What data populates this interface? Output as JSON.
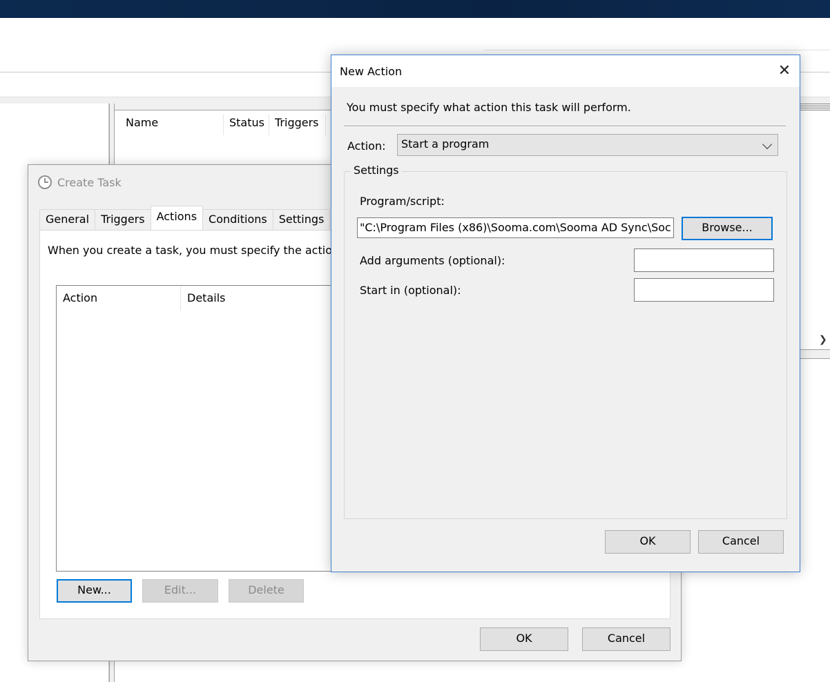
{
  "main_window": {
    "columns": [
      "Name",
      "Status",
      "Triggers"
    ]
  },
  "create_task": {
    "title": "Create Task",
    "tabs": [
      "General",
      "Triggers",
      "Actions",
      "Conditions",
      "Settings"
    ],
    "active_tab": "Actions",
    "description": "When you create a task, you must specify the actio",
    "list_columns": [
      "Action",
      "Details"
    ],
    "buttons": {
      "new": "New...",
      "edit": "Edit...",
      "delete": "Delete",
      "ok": "OK",
      "cancel": "Cancel"
    }
  },
  "new_action": {
    "title": "New Action",
    "intro": "You must specify what action this task will perform.",
    "action_label": "Action:",
    "action_value": "Start a program",
    "settings_label": "Settings",
    "program_label": "Program/script:",
    "program_value": "\"C:\\Program Files (x86)\\Sooma.com\\Sooma AD Sync\\Soc",
    "browse_label": "Browse...",
    "arguments_label": "Add arguments (optional):",
    "arguments_value": "",
    "start_in_label": "Start in (optional):",
    "start_in_value": "",
    "ok_label": "OK",
    "cancel_label": "Cancel"
  },
  "colors": {
    "accent": "#0078d7",
    "title_bar": "#0c2a4f",
    "dialog_bg": "#f0f0f0"
  }
}
